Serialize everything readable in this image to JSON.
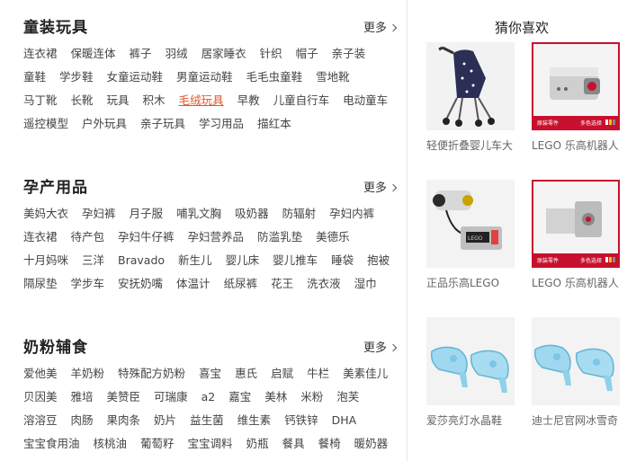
{
  "sections": [
    {
      "title": "童装玩具",
      "more": "更多",
      "rows": [
        [
          "连衣裙",
          "保暖连体",
          "裤子",
          "羽绒",
          "居家睡衣",
          "针织",
          "帽子",
          "亲子装"
        ],
        [
          "童鞋",
          "学步鞋",
          "女童运动鞋",
          "男童运动鞋",
          "毛毛虫童鞋",
          "雪地靴"
        ],
        [
          "马丁靴",
          "长靴",
          "玩具",
          "积木",
          "毛绒玩具",
          "早教",
          "儿童自行车",
          "电动童车"
        ],
        [
          "遥控模型",
          "户外玩具",
          "亲子玩具",
          "学习用品",
          "描红本"
        ]
      ],
      "highlight": "毛绒玩具"
    },
    {
      "title": "孕产用品",
      "more": "更多",
      "rows": [
        [
          "美妈大衣",
          "孕妇裤",
          "月子服",
          "哺乳文胸",
          "吸奶器",
          "防辐射",
          "孕妇内裤"
        ],
        [
          "连衣裙",
          "待产包",
          "孕妇牛仔裤",
          "孕妇营养品",
          "防滥乳垫",
          "美德乐"
        ],
        [
          "十月妈咪",
          "三洋",
          "Bravado",
          "新生儿",
          "婴儿床",
          "婴儿推车",
          "睡袋",
          "抱被"
        ],
        [
          "隔尿垫",
          "学步车",
          "安抚奶嘴",
          "体温计",
          "纸尿裤",
          "花王",
          "洗衣液",
          "湿巾"
        ]
      ],
      "highlight": ""
    },
    {
      "title": "奶粉辅食",
      "more": "更多",
      "rows": [
        [
          "爱他美",
          "羊奶粉",
          "特殊配方奶粉",
          "喜宝",
          "惠氏",
          "启赋",
          "牛栏",
          "美素佳儿"
        ],
        [
          "贝因美",
          "雅培",
          "美赞臣",
          "可瑞康",
          "a2",
          "嘉宝",
          "美林",
          "米粉",
          "泡芙"
        ],
        [
          "溶溶豆",
          "肉肠",
          "果肉条",
          "奶片",
          "益生菌",
          "维生素",
          "钙铁锌",
          "DHA"
        ],
        [
          "宝宝食用油",
          "核桃油",
          "葡萄籽",
          "宝宝调料",
          "奶瓶",
          "餐具",
          "餐椅",
          "暖奶器"
        ]
      ],
      "highlight": ""
    }
  ],
  "guess": {
    "title": "猜你喜欢",
    "products": [
      {
        "caption": "轻便折叠婴儿车大",
        "icon": "stroller-image"
      },
      {
        "caption": "LEGO 乐高机器人",
        "icon": "lego-sensor-image",
        "strip_left": "原装零件",
        "strip_right": "多色选择"
      },
      {
        "caption": "正品乐高LEGO",
        "icon": "lego-motor-image"
      },
      {
        "caption": "LEGO 乐高机器人",
        "icon": "lego-sensor2-image",
        "strip_left": "原装零件",
        "strip_right": "多色选择"
      },
      {
        "caption": "爱莎亮灯水晶鞋",
        "icon": "crystal-shoes-image"
      },
      {
        "caption": "迪士尼官网冰雪奇",
        "icon": "crystal-shoes2-image"
      }
    ]
  },
  "colors": {
    "highlight": "#e4572e",
    "lego_border": "#c8102e"
  }
}
